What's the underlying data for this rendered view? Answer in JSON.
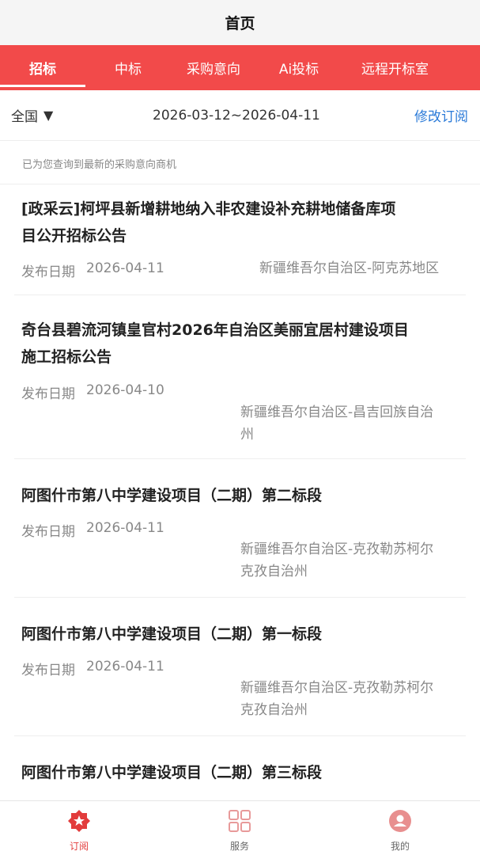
{
  "header": {
    "title": "首页"
  },
  "tabs": [
    {
      "label": "招标",
      "active": true
    },
    {
      "label": "中标",
      "active": false
    },
    {
      "label": "采购意向",
      "active": false
    },
    {
      "label": "Ai投标",
      "active": false
    },
    {
      "label": "远程开标室",
      "active": false
    }
  ],
  "filter": {
    "region": "全国",
    "region_caret": "▼",
    "date_range": "2026-03-12~2026-04-11",
    "edit_label": "修改订阅"
  },
  "notice": "已为您查询到最新的采购意向商机",
  "items": [
    {
      "title_line1": "[政采云]柯坪县新增耕地纳入非农建设补充耕地储备库项",
      "title_line2": "目公开招标公告",
      "date_label": "发布日期",
      "date": "2026-04-11",
      "region_line1": "新疆维吾尔自治区-阿克苏地区",
      "region_line2": ""
    },
    {
      "title_line1": "奇台县碧流河镇皇官村2026年自治区美丽宜居村建设项目",
      "title_line2": "施工招标公告",
      "date_label": "发布日期",
      "date": "2026-04-10",
      "region_line1": "新疆维吾尔自治区-昌吉回族自治",
      "region_line2": "州"
    },
    {
      "title_line1": "阿图什市第八中学建设项目（二期）第二标段",
      "title_line2": "",
      "date_label": "发布日期",
      "date": "2026-04-11",
      "region_line1": "新疆维吾尔自治区-克孜勒苏柯尔",
      "region_line2": "克孜自治州"
    },
    {
      "title_line1": "阿图什市第八中学建设项目（二期）第一标段",
      "title_line2": "",
      "date_label": "发布日期",
      "date": "2026-04-11",
      "region_line1": "新疆维吾尔自治区-克孜勒苏柯尔",
      "region_line2": "克孜自治州"
    },
    {
      "title_line1": "阿图什市第八中学建设项目（二期）第三标段",
      "title_line2": ""
    }
  ],
  "bottom_nav": [
    {
      "label": "订阅",
      "icon": "subscribe-icon",
      "active": true
    },
    {
      "label": "服务",
      "icon": "grid-icon",
      "active": false
    },
    {
      "label": "我的",
      "icon": "user-icon",
      "active": false
    }
  ],
  "colors": {
    "accent": "#f24a4a",
    "link": "#2a7ad8",
    "muted": "#888888"
  }
}
